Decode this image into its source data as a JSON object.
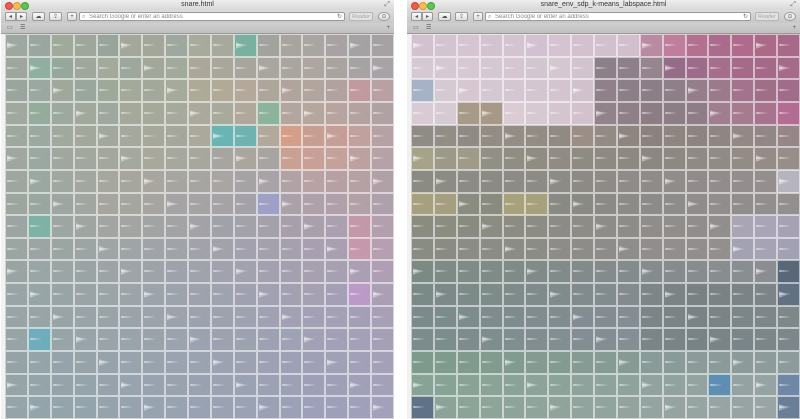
{
  "windows": [
    {
      "title": "snare.html",
      "address_placeholder": "Search Google or enter an address",
      "reader_label": "Reader",
      "icons": {
        "back": "◂",
        "forward": "▸",
        "cloud": "☁",
        "share": "⇪",
        "new_tab": "+",
        "search": "⌕",
        "reload": "↻",
        "downloads": "⊙",
        "reading_list": "▭",
        "top_sites": "☰",
        "add_bookmark": "+",
        "fullscreen": "⤢"
      },
      "grid_rows": [
        [
          "#9ea8a0",
          "#9aa7a0",
          "#a0aa9a",
          "#9fa79d",
          "#98a59a",
          "#a4a89b",
          "#a2a79a",
          "#9fa89e",
          "#a8aa9b",
          "#a6a99c",
          "#7ab0a0",
          "#a2a39d",
          "#a8a49e",
          "#a9a5a0",
          "#a8a3a2",
          "#a4a2a2",
          "#a6a2a4"
        ],
        [
          "#9ea69e",
          "#8fb0a0",
          "#96a89c",
          "#9fa79d",
          "#a3a99b",
          "#9ea79b",
          "#a1a89a",
          "#a3a99b",
          "#aba89a",
          "#a9a79b",
          "#a7a69c",
          "#a8a69e",
          "#aaa59f",
          "#ada5a0",
          "#aaa4a1",
          "#a7a3a3",
          "#a7a3a6"
        ],
        [
          "#9aa59d",
          "#9ba8a1",
          "#a0a89b",
          "#9aa79c",
          "#9ea99a",
          "#a4aa99",
          "#a2a99a",
          "#a6aa9a",
          "#adaa98",
          "#b0aa96",
          "#b3a89a",
          "#ada69b",
          "#b1a49d",
          "#b2a59e",
          "#b1a19f",
          "#c09a9e",
          "#b9a0a3"
        ],
        [
          "#a0a89f",
          "#95ab9c",
          "#9da99e",
          "#a0a99c",
          "#9fa89c",
          "#a4a99c",
          "#a5a99a",
          "#a7a99c",
          "#aaa99c",
          "#a8aa9c",
          "#afa89b",
          "#8cb39c",
          "#b2a69e",
          "#b5a69e",
          "#b8a3a0",
          "#b4a2a1",
          "#b0a2a4"
        ],
        [
          "#9fa89f",
          "#9ba9a0",
          "#a1a89e",
          "#a3a89c",
          "#a2a89d",
          "#a4a89d",
          "#a6a89b",
          "#a5a79d",
          "#aba99b",
          "#6ab4b4",
          "#70b2b0",
          "#b2a89c",
          "#d59e88",
          "#c89e92",
          "#c59e97",
          "#c1a19d",
          "#b6a1a4"
        ],
        [
          "#9fa7a0",
          "#9aa8a1",
          "#a0a79f",
          "#a2a89e",
          "#a3a79c",
          "#a5a89c",
          "#a9a89c",
          "#a6a79d",
          "#a7a79e",
          "#a7a59f",
          "#aba69d",
          "#a8a5a0",
          "#c9a194",
          "#c8a097",
          "#c4a19b",
          "#bca1a0",
          "#b6a1a6"
        ],
        [
          "#9ea69f",
          "#9ba8a2",
          "#9fa7a0",
          "#a2a79f",
          "#a6a79e",
          "#a6a69e",
          "#a8a69f",
          "#a7a59f",
          "#a7a5a1",
          "#a8a5a2",
          "#a6a3a4",
          "#a9a2a6",
          "#b0a2a5",
          "#b8a2a3",
          "#b6a0a3",
          "#b5a1a4",
          "#b0a1a7"
        ],
        [
          "#9ca69f",
          "#9aa7a1",
          "#9ea6a1",
          "#a1a7a0",
          "#a6a69f",
          "#a6a6a0",
          "#a6a5a1",
          "#a5a3a3",
          "#a6a3a4",
          "#a5a3a6",
          "#a4a2a8",
          "#9ea1c5",
          "#aba1a8",
          "#aea1a9",
          "#b1a0aa",
          "#b3a1a8",
          "#aea1ab"
        ],
        [
          "#9ca5a1",
          "#7eb2a5",
          "#9da6a3",
          "#9fa6a2",
          "#a2a5a2",
          "#a3a5a2",
          "#a2a4a4",
          "#a3a3a5",
          "#a2a2a7",
          "#a1a2a9",
          "#a3a1aa",
          "#a4a1ab",
          "#a7a0ab",
          "#aaa0ad",
          "#ab9fb0",
          "#c399a9",
          "#b39fae"
        ],
        [
          "#9ba5a2",
          "#9ca5a4",
          "#9ba6a3",
          "#9da5a4",
          "#9fa5a5",
          "#9fa4a6",
          "#a0a3a7",
          "#a0a3a8",
          "#a1a2aa",
          "#a2a2ab",
          "#a3a1ad",
          "#a4a1ad",
          "#a5a0ae",
          "#a8a0b0",
          "#a99fb0",
          "#c598ac",
          "#b59fb1"
        ],
        [
          "#9aa4a3",
          "#99a6a5",
          "#9aa5a4",
          "#9ba4a5",
          "#9da4a6",
          "#9ea4a8",
          "#9ea3aa",
          "#9ea3ab",
          "#a0a2ac",
          "#a1a2ad",
          "#a2a1ae",
          "#a3a1af",
          "#a5a0b0",
          "#a7a0b1",
          "#a7a0b2",
          "#ab9fb3",
          "#b09fb4"
        ],
        [
          "#98a4a5",
          "#97a5a6",
          "#99a4a6",
          "#9aa4a6",
          "#9ba4a7",
          "#9ca3a9",
          "#9da3aa",
          "#9da3ac",
          "#9ea2ad",
          "#9fa2af",
          "#a0a1b0",
          "#a1a1b1",
          "#a3a0b2",
          "#a6a0b3",
          "#a59fb5",
          "#bc9ac8",
          "#ab9fb5"
        ],
        [
          "#98a4a5",
          "#97a5a7",
          "#98a4a7",
          "#99a4a8",
          "#99a4a9",
          "#9ba3aa",
          "#9ca3ab",
          "#9ca3ad",
          "#9da3ae",
          "#9ea2af",
          "#9ea2b1",
          "#a0a1b2",
          "#a1a1b3",
          "#a3a0b5",
          "#a4a0b6",
          "#a59fb6",
          "#a8a0b6"
        ],
        [
          "#96a4a6",
          "#6fadbc",
          "#97a4a8",
          "#97a4a9",
          "#98a4aa",
          "#99a3ab",
          "#9aa3ac",
          "#9ba3ae",
          "#9ca2af",
          "#9da2b0",
          "#9da2b1",
          "#9ea1b2",
          "#9fa1b4",
          "#a1a0b5",
          "#a2a0b6",
          "#a3a0b7",
          "#a6a0b7"
        ],
        [
          "#96a3a6",
          "#95a4a8",
          "#95a4aa",
          "#96a4aa",
          "#97a3ab",
          "#98a3ad",
          "#99a3ae",
          "#9aa3af",
          "#9ba2b0",
          "#9ca2b1",
          "#9ca2b2",
          "#9da1b3",
          "#9ea1b5",
          "#9fa0b6",
          "#a0a0b7",
          "#a2a0b8",
          "#a4a0b8"
        ],
        [
          "#95a4a7",
          "#94a4a9",
          "#95a4aa",
          "#95a4ab",
          "#96a3ac",
          "#97a3ae",
          "#98a3af",
          "#99a3b0",
          "#9aa2b1",
          "#9ba2b2",
          "#9ba2b3",
          "#9ca1b4",
          "#9da1b6",
          "#9ea0b7",
          "#9fa0b8",
          "#a1a0b9",
          "#a3a0ba"
        ],
        [
          "#94a4a8",
          "#93a4aa",
          "#94a4ab",
          "#94a4ac",
          "#95a3ad",
          "#96a3af",
          "#97a3b0",
          "#98a3b1",
          "#99a2b2",
          "#9aa2b3",
          "#9aa2b4",
          "#9ba1b5",
          "#9ca1b7",
          "#9da0b8",
          "#9ea0b9",
          "#a0a0ba",
          "#a2a0bb"
        ]
      ]
    },
    {
      "title": "snare_env_sdp_k-means_labspace.html",
      "address_placeholder": "Search Google or enter an address",
      "reader_label": "Reader",
      "icons": {
        "back": "◂",
        "forward": "▸",
        "cloud": "☁",
        "share": "⇪",
        "new_tab": "+",
        "search": "⌕",
        "reload": "↻",
        "downloads": "⊙",
        "reading_list": "▭",
        "top_sites": "☰",
        "add_bookmark": "+",
        "fullscreen": "⤢"
      },
      "grid_rows": [
        [
          "#d2c2d0",
          "#d3c4d2",
          "#d6c4d2",
          "#d3c3d1",
          "#d4c3d1",
          "#d2c2d1",
          "#d6c3d2",
          "#d4c1cf",
          "#d3c0ce",
          "#d2bfcd",
          "#b98ba2",
          "#bf7f9c",
          "#b4708f",
          "#ab6b8c",
          "#b06a8c",
          "#aa6a88",
          "#a86888"
        ],
        [
          "#d6c9d3",
          "#d5c8d4",
          "#d8c8d4",
          "#d4c8d2",
          "#d6c6d2",
          "#d2c6d0",
          "#d5c6d1",
          "#d3c3cf",
          "#8c7f89",
          "#8e7f8b",
          "#96848f",
          "#956c88",
          "#9d6c8b",
          "#a56e8d",
          "#a56a89",
          "#a46988",
          "#a66a8a"
        ],
        [
          "#a6b2c6",
          "#d5c9d2",
          "#d6c7d1",
          "#d4c8d2",
          "#d5c7d2",
          "#d4c6d1",
          "#d3c4cf",
          "#d0c1cc",
          "#8f808a",
          "#8d7f88",
          "#8c7e87",
          "#8f7f89",
          "#967d8a",
          "#9b7b8b",
          "#a3728c",
          "#9f6f88",
          "#a16c89"
        ],
        [
          "#d9cbd4",
          "#d7cbd3",
          "#a89a88",
          "#a79887",
          "#dbcbd3",
          "#d6c9d1",
          "#d4c5cf",
          "#d3c1cc",
          "#928289",
          "#8f7f87",
          "#8c7d85",
          "#8d7e86",
          "#8e7d86",
          "#a17d90",
          "#a67a8f",
          "#a7738f",
          "#b36d92"
        ],
        [
          "#8f8b85",
          "#928e86",
          "#8f8a84",
          "#928c85",
          "#938d86",
          "#938c85",
          "#918a83",
          "#9a8e87",
          "#938a84",
          "#8e8580",
          "#8b827f",
          "#8f8580",
          "#8d8481",
          "#8f8683",
          "#938885",
          "#938687",
          "#978688"
        ],
        [
          "#a6a388",
          "#9c9a86",
          "#9f9b88",
          "#928f84",
          "#908d83",
          "#8f8c82",
          "#908c83",
          "#8f8b82",
          "#8e8a82",
          "#8d8981",
          "#8c8881",
          "#8d8982",
          "#8f8a84",
          "#918b85",
          "#928b86",
          "#958c88",
          "#978d89"
        ],
        [
          "#8b8b84",
          "#8c8c85",
          "#8c8b85",
          "#8b8a84",
          "#8c8b85",
          "#8d8b86",
          "#8d8b86",
          "#8d8a86",
          "#8e8b87",
          "#8e8b88",
          "#8f8b89",
          "#908c8a",
          "#918c8b",
          "#928d8c",
          "#938d8d",
          "#958e8e",
          "#b6b5bf"
        ],
        [
          "#a7a07f",
          "#a59f80",
          "#8a8c7f",
          "#8a8b7f",
          "#a8a27c",
          "#a6a07d",
          "#898a83",
          "#8a8a84",
          "#8b8a86",
          "#8c8b87",
          "#8d8b89",
          "#8e8c8a",
          "#8f8c8b",
          "#908d8c",
          "#918d8d",
          "#928e8e",
          "#948f8f"
        ],
        [
          "#8a8c80",
          "#8b8d81",
          "#8a8b80",
          "#8b8c82",
          "#8c8c83",
          "#8c8c84",
          "#8c8b85",
          "#8d8c86",
          "#8e8c88",
          "#8e8c89",
          "#8f8c8a",
          "#908d8b",
          "#918d8c",
          "#928e8d",
          "#a9a5b5",
          "#aaa5b6",
          "#a6a2b4"
        ],
        [
          "#898c83",
          "#8a8c84",
          "#8b8c85",
          "#8b8c86",
          "#8c8c86",
          "#8c8c87",
          "#8d8c88",
          "#8e8c89",
          "#8e8c8a",
          "#8f8d8b",
          "#908d8c",
          "#918e8d",
          "#928e8e",
          "#938f8f",
          "#a3a2b2",
          "#a5a3b4",
          "#a2a1b3"
        ],
        [
          "#7c8a84",
          "#7d8b85",
          "#7e8b86",
          "#7e8b86",
          "#7f8b87",
          "#808b88",
          "#818b89",
          "#828b8a",
          "#838b8b",
          "#848b8c",
          "#858c8d",
          "#868c8e",
          "#878d8f",
          "#888d90",
          "#898e91",
          "#8a8e92",
          "#586878"
        ],
        [
          "#7a8a87",
          "#7b8a88",
          "#7c8a88",
          "#7d8b89",
          "#7e8b8a",
          "#7f8b8b",
          "#808b8c",
          "#818b8d",
          "#828b8e",
          "#838b8f",
          "#7d8586",
          "#7b8384",
          "#798183",
          "#7a8284",
          "#7b8386",
          "#7c8487",
          "#627182"
        ],
        [
          "#7b8b8b",
          "#7c8b8c",
          "#7d8c8d",
          "#7e8c8e",
          "#7f8c8f",
          "#808c90",
          "#818c91",
          "#828c92",
          "#838c93",
          "#848c94",
          "#7b8587",
          "#7a8486",
          "#798385",
          "#7a8486",
          "#7c8588",
          "#7d8689",
          "#7e878a"
        ],
        [
          "#7b8c8c",
          "#7c8d8d",
          "#7d8d8e",
          "#7e8e8f",
          "#7f8e90",
          "#808e91",
          "#818e92",
          "#828e93",
          "#838e94",
          "#848e95",
          "#798587",
          "#788486",
          "#778385",
          "#788486",
          "#798588",
          "#7a8689",
          "#7b878a"
        ],
        [
          "#7e9a8c",
          "#7f9b8d",
          "#809b8e",
          "#819b8f",
          "#829b90",
          "#839b91",
          "#849b92",
          "#859b93",
          "#869b94",
          "#879b95",
          "#889b96",
          "#899b97",
          "#8a9b98",
          "#8b9b99",
          "#8c9b9a",
          "#8d9b9b",
          "#8e9b9c"
        ],
        [
          "#86a394",
          "#87a395",
          "#88a396",
          "#89a397",
          "#8aa398",
          "#8ba399",
          "#8ca39a",
          "#8da39b",
          "#8ea39c",
          "#8fa39d",
          "#90a39e",
          "#91a39f",
          "#92a3a0",
          "#5e8fb2",
          "#94a3a2",
          "#95a3a3",
          "#6f88a8"
        ],
        [
          "#5f7286",
          "#8ba497",
          "#8ca498",
          "#8da499",
          "#8ea49a",
          "#8fa49b",
          "#90a49c",
          "#91a49d",
          "#92a49e",
          "#93a49f",
          "#94a4a0",
          "#95a4a1",
          "#96a4a2",
          "#97a4a3",
          "#98a4a4",
          "#99a4a5",
          "#6a7f97"
        ]
      ]
    }
  ]
}
